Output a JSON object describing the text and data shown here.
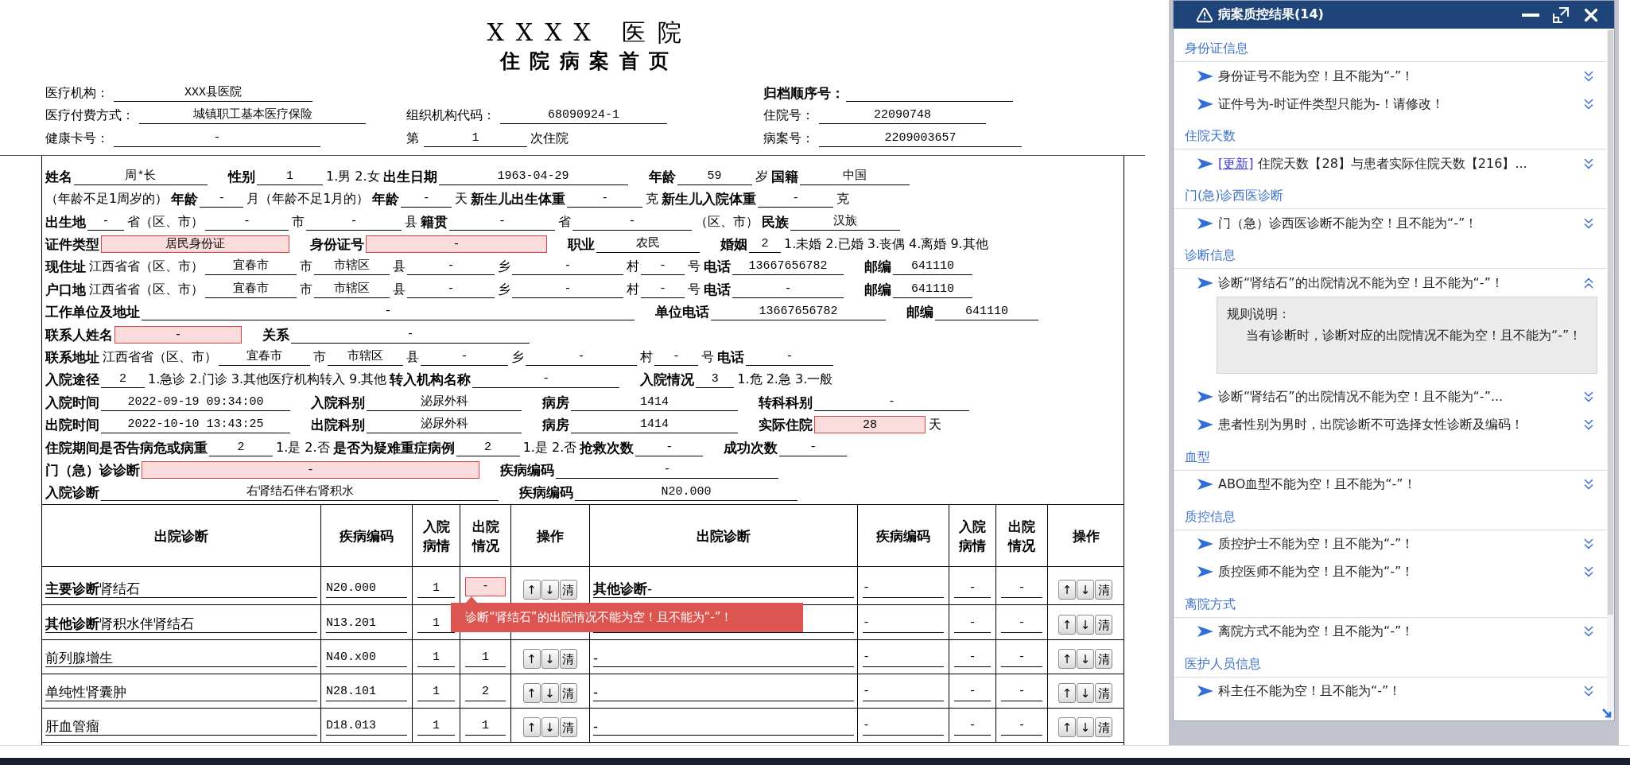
{
  "document": {
    "title": "XXXX 医院",
    "subtitle": "住院病案首页"
  },
  "header_lines": [
    {
      "left": [
        {
          "kind": "text",
          "text": "医疗机构："
        },
        {
          "kind": "field",
          "value": "XXX县医院"
        }
      ],
      "right": [
        {
          "kind": "label",
          "text": "归档顺序号："
        },
        {
          "kind": "field"
        }
      ]
    },
    {
      "left": [
        {
          "kind": "text",
          "text": "医疗付费方式："
        },
        {
          "kind": "field",
          "value": "城镇职工基本医疗保险"
        }
      ],
      "middle": [
        {
          "kind": "text",
          "text": "组织机构代码："
        },
        {
          "kind": "field",
          "value": "68090924-1"
        }
      ],
      "right": [
        {
          "kind": "text",
          "text": "住院号："
        },
        {
          "kind": "field",
          "value": "22090748"
        }
      ]
    },
    {
      "left": [
        {
          "kind": "text",
          "text": "健康卡号："
        },
        {
          "kind": "field",
          "value": "-"
        }
      ],
      "middle": [
        {
          "kind": "text",
          "text": "第"
        },
        {
          "kind": "field",
          "value": "1"
        },
        {
          "kind": "text",
          "text": "次住院"
        }
      ],
      "right": [
        {
          "kind": "text",
          "text": "病案号："
        },
        {
          "kind": "field",
          "value": "2209003657"
        }
      ]
    }
  ],
  "form": {
    "lines": [
      {
        "items": [
          {
            "kind": "label",
            "text": "姓名"
          },
          {
            "kind": "field",
            "value": "周*长"
          },
          {
            "kind": "label",
            "text": "性别"
          },
          {
            "kind": "field",
            "value": "1"
          },
          {
            "kind": "text",
            "text": "1.男 2.女"
          },
          {
            "kind": "label",
            "text": "出生日期"
          },
          {
            "kind": "field",
            "value": "1963-04-29"
          },
          {
            "kind": "label",
            "text": "年龄"
          },
          {
            "kind": "field",
            "value": "59"
          },
          {
            "kind": "text",
            "text": "岁"
          },
          {
            "kind": "label",
            "text": "国籍"
          },
          {
            "kind": "field",
            "value": "中国"
          }
        ]
      },
      {
        "items": [
          {
            "kind": "text",
            "text": "（年龄不足1周岁的）"
          },
          {
            "kind": "label",
            "text": "年龄"
          },
          {
            "kind": "field",
            "value": "-"
          },
          {
            "kind": "text",
            "text": "月（年龄不足1月的）"
          },
          {
            "kind": "label",
            "text": "年龄"
          },
          {
            "kind": "field",
            "value": "-"
          },
          {
            "kind": "text",
            "text": "天"
          },
          {
            "kind": "label",
            "text": "新生儿出生体重"
          },
          {
            "kind": "field",
            "value": "-"
          },
          {
            "kind": "text",
            "text": "克"
          },
          {
            "kind": "label",
            "text": "新生儿入院体重"
          },
          {
            "kind": "field",
            "value": "-"
          },
          {
            "kind": "text",
            "text": "克"
          }
        ]
      },
      {
        "items": [
          {
            "kind": "label",
            "text": "出生地"
          },
          {
            "kind": "field",
            "value": "-"
          },
          {
            "kind": "text",
            "text": "省（区、市）"
          },
          {
            "kind": "field",
            "value": "-"
          },
          {
            "kind": "text",
            "text": "市"
          },
          {
            "kind": "field",
            "value": "-"
          },
          {
            "kind": "text",
            "text": "县"
          },
          {
            "kind": "label",
            "text": "籍贯"
          },
          {
            "kind": "field",
            "value": "-"
          },
          {
            "kind": "text",
            "text": "省"
          },
          {
            "kind": "field",
            "value": "-"
          },
          {
            "kind": "text",
            "text": "（区、市）"
          },
          {
            "kind": "label",
            "text": "民族"
          },
          {
            "kind": "field",
            "value": "汉族"
          }
        ]
      },
      {
        "items": [
          {
            "kind": "label",
            "text": "证件类型"
          },
          {
            "kind": "field",
            "value": "居民身份证",
            "error": true
          },
          {
            "kind": "label",
            "text": "身份证号"
          },
          {
            "kind": "field",
            "value": "-",
            "error": true
          },
          {
            "kind": "label",
            "text": "职业"
          },
          {
            "kind": "field",
            "value": "农民"
          },
          {
            "kind": "label",
            "text": "婚姻"
          },
          {
            "kind": "field",
            "value": "2"
          },
          {
            "kind": "text",
            "text": "1.未婚 2.已婚 3.丧偶 4.离婚 9.其他"
          }
        ]
      },
      {
        "items": [
          {
            "kind": "label",
            "text": "现住址"
          },
          {
            "kind": "text",
            "text": "江西省省（区、市）"
          },
          {
            "kind": "field",
            "value": "宜春市"
          },
          {
            "kind": "text",
            "text": "市"
          },
          {
            "kind": "field",
            "value": "市辖区"
          },
          {
            "kind": "text",
            "text": "县"
          },
          {
            "kind": "field",
            "value": "-"
          },
          {
            "kind": "text",
            "text": "乡"
          },
          {
            "kind": "field",
            "value": "-"
          },
          {
            "kind": "text",
            "text": "村"
          },
          {
            "kind": "field",
            "value": "-"
          },
          {
            "kind": "text",
            "text": "号"
          },
          {
            "kind": "label",
            "text": "电话"
          },
          {
            "kind": "field",
            "value": "13667656782"
          },
          {
            "kind": "label",
            "text": "邮编"
          },
          {
            "kind": "field",
            "value": "641110"
          }
        ]
      },
      {
        "items": [
          {
            "kind": "label",
            "text": "户口地"
          },
          {
            "kind": "text",
            "text": "江西省省（区、市）"
          },
          {
            "kind": "field",
            "value": "宜春市"
          },
          {
            "kind": "text",
            "text": "市"
          },
          {
            "kind": "field",
            "value": "市辖区"
          },
          {
            "kind": "text",
            "text": "县"
          },
          {
            "kind": "field",
            "value": "-"
          },
          {
            "kind": "text",
            "text": "乡"
          },
          {
            "kind": "field",
            "value": "-"
          },
          {
            "kind": "text",
            "text": "村"
          },
          {
            "kind": "field",
            "value": "-"
          },
          {
            "kind": "text",
            "text": "号"
          },
          {
            "kind": "label",
            "text": "电话"
          },
          {
            "kind": "field",
            "value": "-"
          },
          {
            "kind": "label",
            "text": "邮编"
          },
          {
            "kind": "field",
            "value": "641110"
          }
        ]
      },
      {
        "items": [
          {
            "kind": "label",
            "text": "工作单位及地址"
          },
          {
            "kind": "field",
            "value": "-"
          },
          {
            "kind": "label",
            "text": "单位电话"
          },
          {
            "kind": "field",
            "value": "13667656782"
          },
          {
            "kind": "label",
            "text": "邮编"
          },
          {
            "kind": "field",
            "value": "641110"
          }
        ]
      },
      {
        "items": [
          {
            "kind": "label",
            "text": "联系人姓名"
          },
          {
            "kind": "field",
            "value": "-",
            "error": true
          },
          {
            "kind": "label",
            "text": "关系"
          },
          {
            "kind": "field",
            "value": "-"
          }
        ]
      },
      {
        "items": [
          {
            "kind": "label",
            "text": "联系地址"
          },
          {
            "kind": "text",
            "text": "江西省省（区、市）"
          },
          {
            "kind": "field",
            "value": "宜春市"
          },
          {
            "kind": "text",
            "text": "市"
          },
          {
            "kind": "field",
            "value": "市辖区"
          },
          {
            "kind": "text",
            "text": "县"
          },
          {
            "kind": "field",
            "value": "-"
          },
          {
            "kind": "text",
            "text": "乡"
          },
          {
            "kind": "field",
            "value": "-"
          },
          {
            "kind": "text",
            "text": "村"
          },
          {
            "kind": "field",
            "value": "-"
          },
          {
            "kind": "text",
            "text": "号"
          },
          {
            "kind": "label",
            "text": "电话"
          },
          {
            "kind": "field",
            "value": "-"
          }
        ]
      },
      {
        "items": [
          {
            "kind": "label",
            "text": "入院途径"
          },
          {
            "kind": "field",
            "value": "2"
          },
          {
            "kind": "text",
            "text": "1.急诊 2.门诊 3.其他医疗机构转入 9.其他"
          },
          {
            "kind": "label",
            "text": "转入机构名称"
          },
          {
            "kind": "field",
            "value": "-"
          },
          {
            "kind": "label",
            "text": "入院情况"
          },
          {
            "kind": "field",
            "value": "3"
          },
          {
            "kind": "text",
            "text": "1.危 2.急 3.一般"
          }
        ]
      },
      {
        "items": [
          {
            "kind": "label",
            "text": "入院时间"
          },
          {
            "kind": "field",
            "value": "2022-09-19 09:34:00"
          },
          {
            "kind": "label",
            "text": "入院科别"
          },
          {
            "kind": "field",
            "value": "泌尿外科"
          },
          {
            "kind": "label",
            "text": "病房"
          },
          {
            "kind": "field",
            "value": "1414"
          },
          {
            "kind": "label",
            "text": "转科科别"
          },
          {
            "kind": "field",
            "value": "-"
          }
        ]
      },
      {
        "items": [
          {
            "kind": "label",
            "text": "出院时间"
          },
          {
            "kind": "field",
            "value": "2022-10-10 13:43:25"
          },
          {
            "kind": "label",
            "text": "出院科别"
          },
          {
            "kind": "field",
            "value": "泌尿外科"
          },
          {
            "kind": "label",
            "text": "病房"
          },
          {
            "kind": "field",
            "value": "1414"
          },
          {
            "kind": "label",
            "text": "实际住院"
          },
          {
            "kind": "field",
            "value": "28",
            "error": true
          },
          {
            "kind": "text",
            "text": "天"
          }
        ]
      },
      {
        "items": [
          {
            "kind": "label",
            "text": "住院期间是否告病危或病重"
          },
          {
            "kind": "field",
            "value": "2"
          },
          {
            "kind": "text",
            "text": "1.是 2.否"
          },
          {
            "kind": "label",
            "text": "是否为疑难重症病例"
          },
          {
            "kind": "field",
            "value": "2"
          },
          {
            "kind": "text",
            "text": "1.是 2.否"
          },
          {
            "kind": "label",
            "text": "抢救次数"
          },
          {
            "kind": "field",
            "value": "-"
          },
          {
            "kind": "label",
            "text": "成功次数"
          },
          {
            "kind": "field",
            "value": "-"
          }
        ]
      },
      {
        "items": [
          {
            "kind": "label",
            "text": "门（急）诊诊断"
          },
          {
            "kind": "field",
            "value": "-",
            "error": true
          },
          {
            "kind": "label",
            "text": "疾病编码"
          },
          {
            "kind": "field",
            "value": "-"
          }
        ]
      },
      {
        "items": [
          {
            "kind": "label",
            "text": "入院诊断"
          },
          {
            "kind": "field",
            "value": "右肾结石伴右肾积水"
          },
          {
            "kind": "label",
            "text": "疾病编码"
          },
          {
            "kind": "field",
            "value": "N20.000"
          }
        ]
      }
    ]
  },
  "table": {
    "columns": [
      "出院诊断",
      "疾病编码",
      "入院病情",
      "出院情况",
      "操作",
      "出院诊断",
      "疾病编码",
      "入院病情",
      "出院情况",
      "操作"
    ],
    "rows": [
      {
        "left": {
          "diagnosis": "**主要诊断**肾结石",
          "code": "N20.000",
          "admission": "1",
          "discharge": "-",
          "discharge_error": true,
          "actions": [
            "↑",
            "↓",
            "清"
          ]
        },
        "right": {
          "diagnosis": "**其他诊断**-",
          "code": "-",
          "admission": "-",
          "discharge": "-",
          "actions": [
            "↑",
            "↓",
            "清"
          ]
        }
      },
      {
        "left": {
          "diagnosis": "**其他诊断**肾积水伴肾结石",
          "code": "N13.201",
          "admission": "1"
        },
        "right": {
          "code": "-",
          "admission": "-",
          "discharge": "-",
          "actions": [
            "↑",
            "↓",
            "清"
          ]
        }
      },
      {
        "left": {
          "diagnosis": "前列腺增生",
          "code": "N40.x00",
          "admission": "1",
          "discharge": "1",
          "actions": [
            "↑",
            "↓",
            "清"
          ]
        },
        "right": {
          "diagnosis": "-",
          "code": "-",
          "admission": "-",
          "discharge": "-",
          "actions": [
            "↑",
            "↓",
            "清"
          ]
        }
      },
      {
        "left": {
          "diagnosis": "单纯性肾囊肿",
          "code": "N28.101",
          "admission": "1",
          "discharge": "2",
          "actions": [
            "↑",
            "↓",
            "清"
          ]
        },
        "right": {
          "diagnosis": "-",
          "code": "-",
          "admission": "-",
          "discharge": "-",
          "actions": [
            "↑",
            "↓",
            "清"
          ]
        }
      },
      {
        "left": {
          "diagnosis": "肝血管瘤",
          "code": "D18.013",
          "admission": "1",
          "discharge": "1",
          "actions": [
            "↑",
            "↓",
            "清"
          ]
        },
        "right": {
          "diagnosis": "-",
          "code": "-",
          "admission": "-",
          "discharge": "-",
          "actions": [
            "↑",
            "↓",
            "清"
          ]
        }
      }
    ]
  },
  "tooltip": {
    "text": "诊断“肾结石”的出院情况不能为空！且不能为“-”！"
  },
  "qc_panel": {
    "title": "病案质控结果(14)",
    "groups": [
      {
        "title": "身份证信息",
        "items": [
          {
            "text": "身份证号不能为空！且不能为“-”！",
            "expanded": false
          },
          {
            "text": "证件号为-时证件类型只能为-！请修改！",
            "expanded": false
          }
        ]
      },
      {
        "title": "住院天数",
        "items": [
          {
            "link": "[更新]",
            "text": "住院天数【28】与患者实际住院天数【216】...",
            "expanded": false
          }
        ]
      },
      {
        "title": "门(急)诊西医诊断",
        "items": [
          {
            "text": "门（急）诊西医诊断不能为空！且不能为“-”！",
            "expanded": false
          }
        ]
      },
      {
        "title": "诊断信息",
        "items": [
          {
            "text": "诊断“肾结石”的出院情况不能为空！且不能为“-”！",
            "expanded": true,
            "rule": {
              "title": "规则说明：",
              "body": "当有诊断时，诊断对应的出院情况不能为空！且不能为“-”！"
            }
          },
          {
            "text": "诊断“肾结石”的出院情况不能为空！且不能为“-”...",
            "expanded": false
          },
          {
            "text": "患者性别为男时，出院诊断不可选择女性诊断及编码！",
            "expanded": false
          }
        ]
      },
      {
        "title": "血型",
        "items": [
          {
            "text": "ABO血型不能为空！且不能为“-”！",
            "expanded": false
          }
        ]
      },
      {
        "title": "质控信息",
        "items": [
          {
            "text": "质控护士不能为空！且不能为“-”！",
            "expanded": false
          },
          {
            "text": "质控医师不能为空！且不能为“-”！",
            "expanded": false
          }
        ]
      },
      {
        "title": "离院方式",
        "items": [
          {
            "text": "离院方式不能为空！且不能为“-”！",
            "expanded": false
          }
        ]
      },
      {
        "title": "医护人员信息",
        "items": [
          {
            "text": "科主任不能为空！且不能为“-”！",
            "expanded": false
          }
        ]
      }
    ]
  }
}
